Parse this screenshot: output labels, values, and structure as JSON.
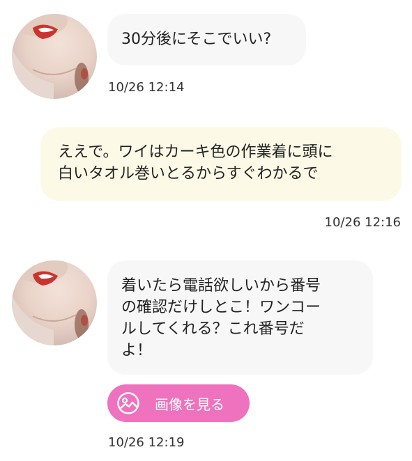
{
  "messages": [
    {
      "sender": "other",
      "text": "30分後にそこでいい?",
      "time": "10/26 12:14"
    },
    {
      "sender": "self",
      "text": "ええで。ワイはカーキ色の作業着に頭に\n白いタオル巻いとるからすぐわかるで",
      "time": "10/26 12:16"
    },
    {
      "sender": "other",
      "text": "着いたら電話欲しいから番号\nの確認だけしとこ！ワンコー\nルしてくれる？これ番号だ\nよ！",
      "time": "10/26 12:19",
      "attachment_button": {
        "label": "画像を見る",
        "icon": "image-icon"
      }
    }
  ],
  "colors": {
    "incoming_bubble": "#f7f7f7",
    "outgoing_bubble": "#fdf9e7",
    "button_accent": "#ee72bd",
    "timestamp_text": "#333333"
  }
}
